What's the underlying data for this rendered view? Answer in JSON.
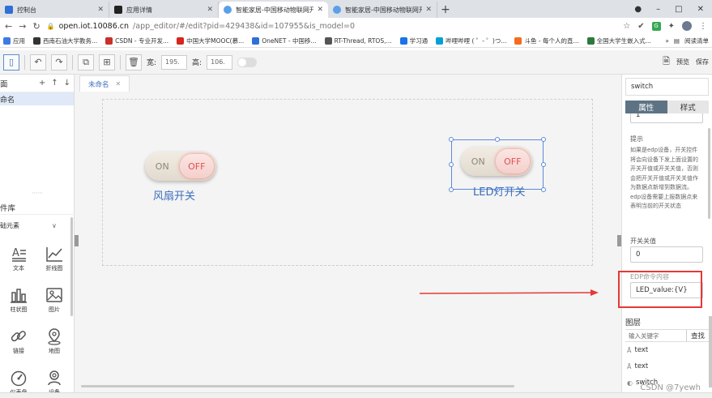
{
  "browser": {
    "tabs": [
      {
        "title": "控制台",
        "favicon_color": "#2f6fd6",
        "active": false
      },
      {
        "title": "应用详情",
        "favicon_color": "#222222",
        "active": false
      },
      {
        "title": "智能家居-中国移动物联网开放平",
        "favicon_color": "#5aa0e8",
        "active": true
      },
      {
        "title": "智能家居-中国移动物联网开放平",
        "favicon_color": "#5aa0e8",
        "active": false
      }
    ],
    "new_tab": "+",
    "window_controls": [
      "–",
      "□",
      "✕"
    ],
    "url_host": "open.iot.10086.cn",
    "url_path": "/app_editor/#/edit?pid=429438&id=107955&is_model=0",
    "bookmarks": [
      "应用",
      "西南石油大学教务...",
      "CSDN - 专业开发...",
      "中国大学MOOC(慕...",
      "OneNET - 中国移...",
      "RT-Thread, RTOS,...",
      "学习通",
      "哔哩哔哩 ( ゜- ゜)つ...",
      "斗鱼 - 每个人的直...",
      "全国大学生嵌入式..."
    ],
    "bookmark_colors": [
      "#3c7be3",
      "#333333",
      "#c9302c",
      "#d6261f",
      "#2f6fd6",
      "#555555",
      "#1a73e8",
      "#00a1d6",
      "#f36c21",
      "#2b7a3d"
    ],
    "reading_list": "阅读清单",
    "more_bookmarks": "»"
  },
  "toolbar": {
    "width_label": "宽:",
    "width_value": "195.",
    "height_label": "高:",
    "height_value": "106.",
    "preview_label": "预览",
    "save_label": "保存"
  },
  "left_panel": {
    "pages_title": "面",
    "page_item": "命名",
    "library_title": "件库",
    "basic_elements": "础元素",
    "components": [
      {
        "label": "文本",
        "icon": "text-icon"
      },
      {
        "label": "折线图",
        "icon": "line-chart-icon"
      },
      {
        "label": "柱状图",
        "icon": "bar-chart-icon"
      },
      {
        "label": "图片",
        "icon": "image-icon"
      },
      {
        "label": "链接",
        "icon": "link-icon"
      },
      {
        "label": "地图",
        "icon": "map-icon"
      },
      {
        "label": "仪表盘",
        "icon": "gauge-icon"
      },
      {
        "label": "设备",
        "icon": "device-icon"
      }
    ]
  },
  "canvas": {
    "doc_tab": "未命名",
    "switch1": {
      "on": "ON",
      "off": "OFF",
      "label": "风扇开关"
    },
    "switch2": {
      "on": "ON",
      "off": "OFF",
      "label": "LED灯开关"
    }
  },
  "right_panel": {
    "component_name": "switch",
    "tab_properties": "属性",
    "tab_style": "样式",
    "top_value": "1",
    "hint_label": "提示",
    "hint_text": "如果是edp设备，开关控件将会向设备下发上面设置的开关开值或开关关值，否则会把开关开值或开关关值作为数据点新增到数据流。edp设备需要上报数据点来表明当前的开关状态",
    "off_value_label": "开关关值",
    "off_value": "0",
    "edp_label": "EDP命令内容",
    "edp_value": "LED_value:{V}",
    "layers_title": "图层",
    "search_placeholder": "输入关键字",
    "search_button": "查找",
    "layers": [
      "text",
      "text",
      "switch"
    ]
  },
  "watermark": "CSDN @7yewh",
  "colors": {
    "accent": "#3a6dbd",
    "highlight": "#e53935",
    "tab_active": "#5d7384"
  }
}
